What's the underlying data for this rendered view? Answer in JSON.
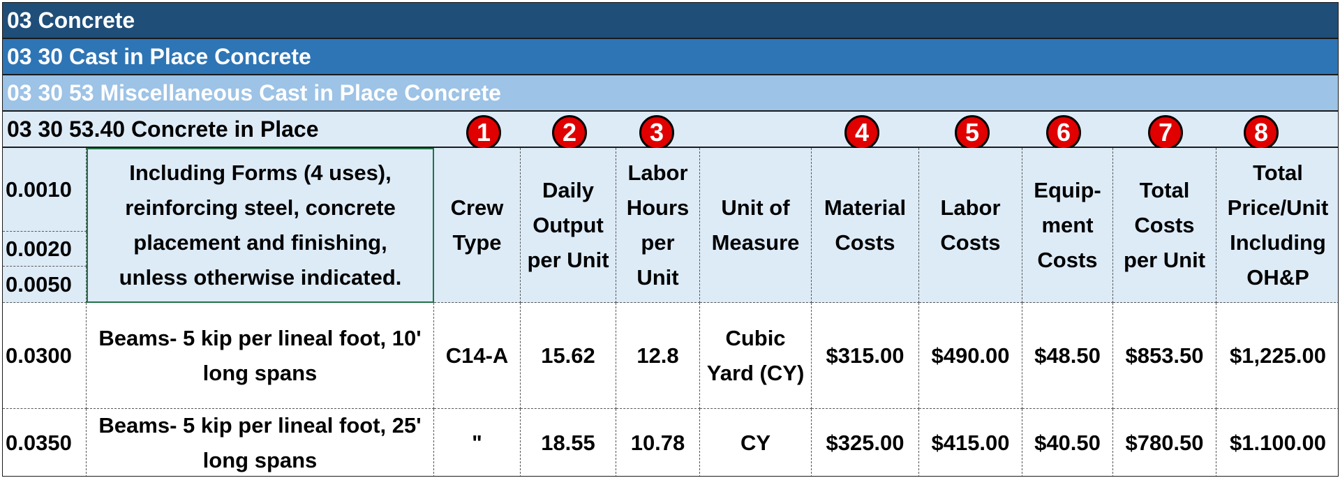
{
  "bands": {
    "division": "03 Concrete",
    "section": "03 30 Cast in Place Concrete",
    "subsection": "03 30 53 Miscellaneous Cast in Place Concrete",
    "item": "03 30 53.40 Concrete in Place"
  },
  "badges": [
    "1",
    "2",
    "3",
    "4",
    "5",
    "6",
    "7",
    "8"
  ],
  "header": {
    "codes": [
      "0.0010",
      "0.0020",
      "0.0050"
    ],
    "description": "Including Forms (4 uses), reinforcing steel, concrete placement and finishing, unless otherwise indicated.",
    "crew": "Crew Type",
    "daily_output": "Daily Output per Unit",
    "labor_hours": "Labor Hours per Unit",
    "unit": "Unit of Measure",
    "material": "Material Costs",
    "labor": "Labor Costs",
    "equipment": "Equip- ment Costs",
    "total": "Total Costs per Unit",
    "total_op": "Total Price/Unit Including OH&P"
  },
  "rows": [
    {
      "code": "0.0300",
      "description": "Beams- 5 kip per lineal foot, 10' long spans",
      "crew": "C14-A",
      "daily_output": "15.62",
      "labor_hours": "12.8",
      "unit": "Cubic Yard (CY)",
      "material": "$315.00",
      "labor": "$490.00",
      "equipment": "$48.50",
      "total": "$853.50",
      "total_op": "$1,225.00"
    },
    {
      "code": "0.0350",
      "description": "Beams- 5 kip per lineal foot, 25' long spans",
      "crew": "\"",
      "daily_output": "18.55",
      "labor_hours": "10.78",
      "unit": "CY",
      "material": "$325.00",
      "labor": "$415.00",
      "equipment": "$40.50",
      "total": "$780.50",
      "total_op": "$1.100.00"
    }
  ]
}
